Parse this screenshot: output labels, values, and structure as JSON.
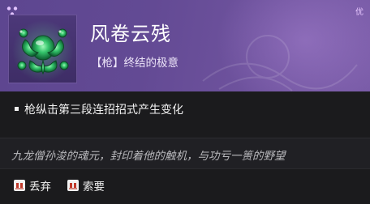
{
  "item": {
    "name": "风卷云残",
    "subtitle": "【枪】终结的极意",
    "rarity_badge": "优",
    "rarity_color": "#6a4f9c",
    "icon": "green-serpent-jade-icon"
  },
  "effect": {
    "text": "枪纵击第三段连招招式产生变化"
  },
  "lore": {
    "text": "九龙僧孙浚的魂元，封印着他的触机，与功亏一篑的野望"
  },
  "actions": [
    {
      "label": "丢弃",
      "icon": "key-prompt-icon"
    },
    {
      "label": "索要",
      "icon": "key-prompt-icon"
    }
  ]
}
